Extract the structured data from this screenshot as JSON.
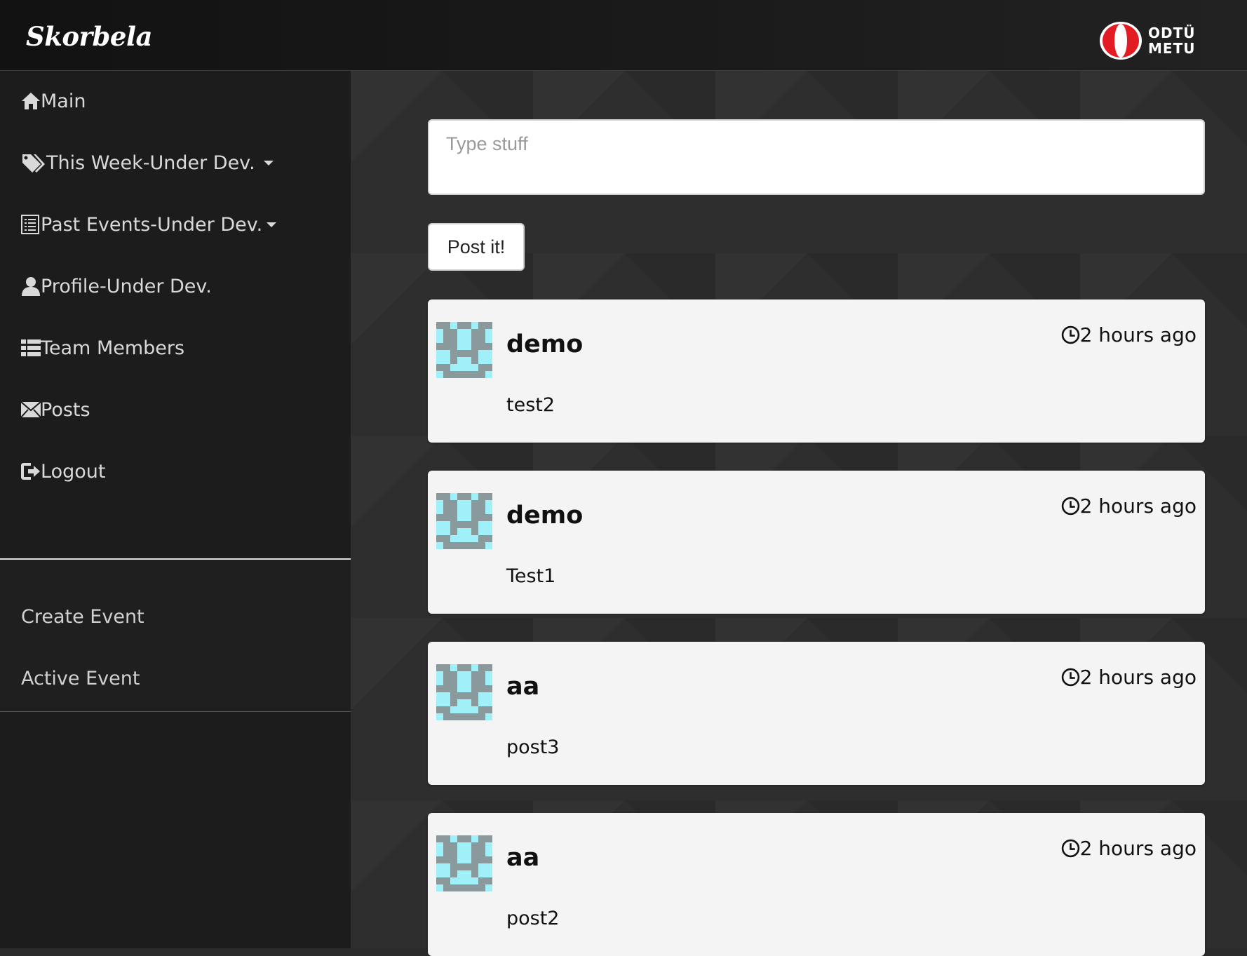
{
  "header": {
    "brand": "Skorbela",
    "logo_text_top": "ODTÜ",
    "logo_text_bottom": "METU",
    "logo_icon": "metu-disc-icon"
  },
  "sidebar": {
    "items": [
      {
        "label": "Main",
        "icon": "home-icon"
      },
      {
        "label": "This Week-Under Dev.",
        "icon": "tags-icon",
        "dropdown": true
      },
      {
        "label": "Past Events-Under Dev.",
        "icon": "list-alt-icon",
        "dropdown": true
      },
      {
        "label": "Profile-Under Dev.",
        "icon": "user-icon"
      },
      {
        "label": "Team Members",
        "icon": "th-list-icon"
      },
      {
        "label": "Posts",
        "icon": "envelope-icon"
      },
      {
        "label": "Logout",
        "icon": "log-out-icon"
      }
    ],
    "sub_items": [
      {
        "label": "Create Event"
      },
      {
        "label": "Active Event"
      }
    ]
  },
  "composer": {
    "placeholder": "Type stuff",
    "value": "",
    "button_label": "Post it!"
  },
  "posts": [
    {
      "author": "demo",
      "time": "2 hours ago",
      "body": "test2"
    },
    {
      "author": "demo",
      "time": "2 hours ago",
      "body": "Test1"
    },
    {
      "author": "aa",
      "time": "2 hours ago",
      "body": "post3"
    },
    {
      "author": "aa",
      "time": "2 hours ago",
      "body": "post2"
    }
  ],
  "colors": {
    "avatar_primary": "#9ff0f8",
    "avatar_secondary": "#8a9a9c",
    "metu_red": "#e31b23"
  }
}
